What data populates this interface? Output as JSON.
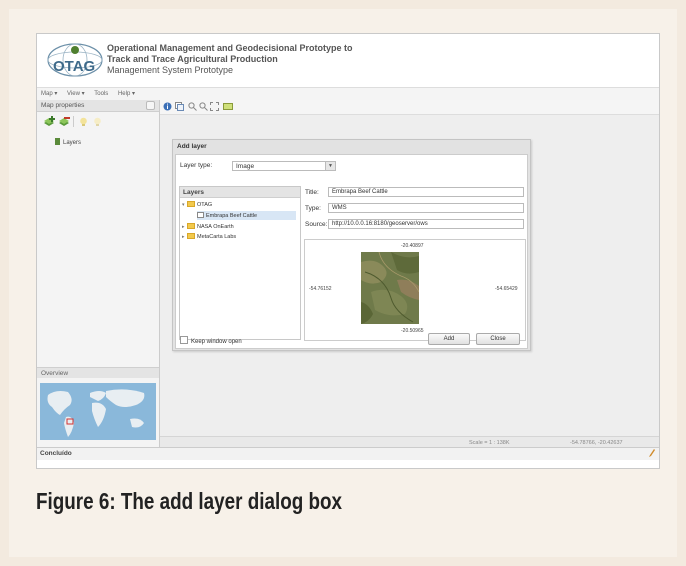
{
  "app": {
    "title_line1": "Operational Management and Geodecisional Prototype to",
    "title_line2": "Track and Trace Agricultural Production",
    "title_line3": "Management System Prototype",
    "logo_text": "OTAG"
  },
  "menubar": [
    "Map ▾",
    "View ▾",
    "Tools",
    "Help ▾"
  ],
  "left_panel": {
    "title": "Map properties",
    "layers_item": "Layers",
    "overview_title": "Overview"
  },
  "dialog": {
    "title": "Add layer",
    "layer_type_label": "Layer type:",
    "layer_type_value": "Image",
    "tree_header": "Layers",
    "tree": {
      "root": "OTAG",
      "child": "Embrapa Beef Cattle",
      "nasa": "NASA OnEarth",
      "metacarta": "MetaCarta Labs"
    },
    "fields": {
      "title_label": "Title:",
      "title_value": "Embrapa Beef Cattle",
      "type_label": "Type:",
      "type_value": "WMS",
      "source_label": "Source:",
      "source_value": "http://10.0.0.16:8180/geoserver/ows"
    },
    "extent": {
      "north": "-20.40897",
      "south": "-20.50965",
      "west": "-54.76152",
      "east": "-54.65429"
    },
    "keep_open_label": "Keep window open",
    "add_button": "Add",
    "close_button": "Close"
  },
  "scalebar": {
    "scale": "Scale = 1 : 138K",
    "coords": "-54.78766, -20.42637"
  },
  "status": "Concluído",
  "caption": "Figure 6: The add layer dialog box",
  "colors": {
    "accent_green": "#5a8a3a",
    "folder": "#f2c94c",
    "selection": "#d8e6f5"
  }
}
